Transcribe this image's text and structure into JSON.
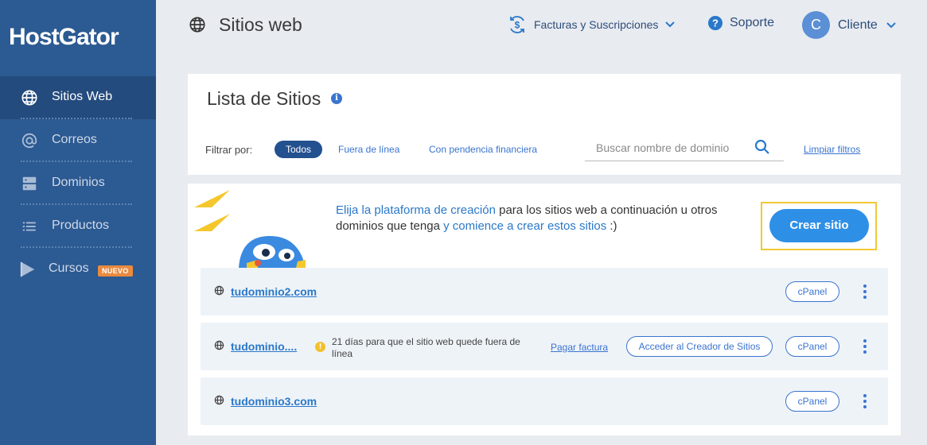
{
  "brand": {
    "logo": "HostGator"
  },
  "sidebar": {
    "items": [
      {
        "label": "Sitios Web",
        "icon": "globe-icon",
        "active": true
      },
      {
        "label": "Correos",
        "icon": "at-icon"
      },
      {
        "label": "Dominios",
        "icon": "server-icon"
      },
      {
        "label": "Productos",
        "icon": "list-icon"
      },
      {
        "label": "Cursos",
        "icon": "play-icon",
        "badge": "NUEVO"
      }
    ]
  },
  "header": {
    "title": "Sitios web",
    "billing": "Facturas y Suscripciones",
    "support": "Soporte",
    "user_initial": "C",
    "user_name": "Cliente"
  },
  "list": {
    "title": "Lista de Sitios",
    "filter_label": "Filtrar por:",
    "filters": [
      "Todos",
      "Fuera de línea",
      "Con pendencia financiera"
    ],
    "active_filter": "Todos",
    "search_placeholder": "Buscar nombre de dominio",
    "clear_filters": "Limpiar filtros"
  },
  "promo": {
    "part1": "Elija la plataforma de creación",
    "part2": " para los sitios web a continuación u otros dominios que tenga ",
    "part3": "y comience a crear estos sitios",
    "part4": " :)",
    "button": "Crear sitio"
  },
  "sites": [
    {
      "domain": "tudominio2.com",
      "cpanel": "cPanel"
    },
    {
      "domain": "tudominio....",
      "warning": "21 días para que el sitio web quede fuera de línea",
      "pay_link": "Pagar factura",
      "builder": "Acceder al Creador de Sitios",
      "cpanel": "cPanel"
    },
    {
      "domain": "tudominio3.com",
      "cpanel": "cPanel"
    }
  ],
  "colors": {
    "sidebar": "#2c5a92",
    "accent": "#2e8fe6",
    "highlight": "#f0c934"
  }
}
